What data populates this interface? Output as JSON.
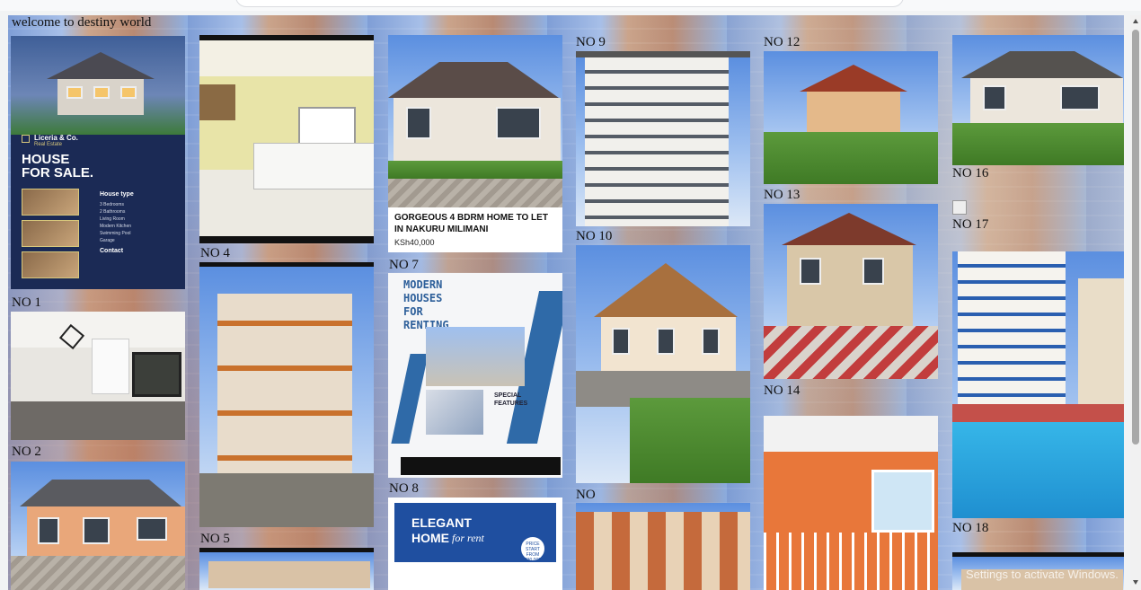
{
  "page": {
    "welcome_text": "welcome to destiny world"
  },
  "labels": {
    "no1": "NO 1",
    "no2": "NO 2",
    "no4": "NO 4",
    "no5": "NO 5",
    "no7": "NO 7",
    "no8": "NO 8",
    "no9": "NO 9",
    "no10": "NO 10",
    "no12": "NO 12",
    "no13": "NO 13",
    "no14": "NO 14",
    "no16": "NO 16",
    "no17": "NO 17",
    "no18": "NO 18",
    "no_partial": "NO"
  },
  "flyer_house_for_sale": {
    "brand": "Liceria & Co.",
    "brand_sub": "Real Estate",
    "title": "HOUSE\nFOR SALE.",
    "house_type_heading": "House type",
    "features": [
      "3 Bedrooms",
      "2 Bathrooms",
      "Living Room",
      "Modern Kitchen",
      "Swimming Pool",
      "Garage"
    ],
    "contact_heading": "Contact"
  },
  "listing_card": {
    "title": "GORGEOUS 4 BDRM HOME TO LET IN NAKURU MILIMANI",
    "price": "KSh40,000"
  },
  "flyer_modern_houses": {
    "title": "MODERN\nHOUSES\nFOR\nRENTING",
    "special": "SPECIAL\nFEATURES"
  },
  "flyer_elegant_home": {
    "line1": "ELEGANT",
    "line2": "HOME",
    "line2_script": "for rent",
    "badge": "PRICE START FROM $30.000"
  },
  "os_watermark": "Settings to activate Windows."
}
